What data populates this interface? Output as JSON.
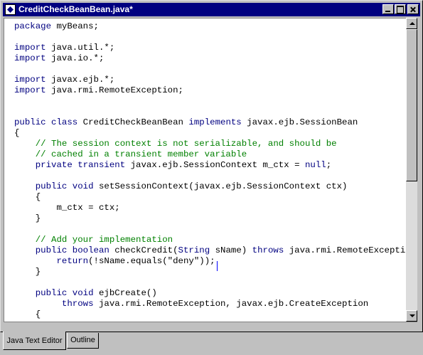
{
  "window": {
    "title": "CreditCheckBeanBean.java*"
  },
  "editor": {
    "lines": [
      [
        {
          "t": "package",
          "c": "kw"
        },
        {
          "t": " myBeans;",
          "c": "st"
        }
      ],
      [],
      [
        {
          "t": "import",
          "c": "kw"
        },
        {
          "t": " java.util.*;",
          "c": "st"
        }
      ],
      [
        {
          "t": "import",
          "c": "kw"
        },
        {
          "t": " java.io.*;",
          "c": "st"
        }
      ],
      [],
      [
        {
          "t": "import",
          "c": "kw"
        },
        {
          "t": " javax.ejb.*;",
          "c": "st"
        }
      ],
      [
        {
          "t": "import",
          "c": "kw"
        },
        {
          "t": " java.rmi.RemoteException;",
          "c": "st"
        }
      ],
      [],
      [],
      [
        {
          "t": "public class",
          "c": "kw"
        },
        {
          "t": " CreditCheckBeanBean ",
          "c": "st"
        },
        {
          "t": "implements",
          "c": "kw"
        },
        {
          "t": " javax.ejb.SessionBean",
          "c": "st"
        }
      ],
      [
        {
          "t": "{",
          "c": "st"
        }
      ],
      [
        {
          "t": "    // The session context is not serializable, and should be",
          "c": "cm"
        }
      ],
      [
        {
          "t": "    // cached in a transient member variable",
          "c": "cm"
        }
      ],
      [
        {
          "t": "    ",
          "c": "st"
        },
        {
          "t": "private transient",
          "c": "kw"
        },
        {
          "t": " javax.ejb.SessionContext m_ctx = ",
          "c": "st"
        },
        {
          "t": "null",
          "c": "kw"
        },
        {
          "t": ";",
          "c": "st"
        }
      ],
      [],
      [
        {
          "t": "    ",
          "c": "st"
        },
        {
          "t": "public void",
          "c": "kw"
        },
        {
          "t": " setSessionContext(javax.ejb.SessionContext ctx)",
          "c": "st"
        }
      ],
      [
        {
          "t": "    {",
          "c": "st"
        }
      ],
      [
        {
          "t": "        m_ctx = ctx;",
          "c": "st"
        }
      ],
      [
        {
          "t": "    }",
          "c": "st"
        }
      ],
      [],
      [
        {
          "t": "    // Add your implementation",
          "c": "cm"
        }
      ],
      [
        {
          "t": "    ",
          "c": "st"
        },
        {
          "t": "public boolean",
          "c": "kw"
        },
        {
          "t": " checkCredit(",
          "c": "st"
        },
        {
          "t": "String",
          "c": "kw"
        },
        {
          "t": " sName) ",
          "c": "st"
        },
        {
          "t": "throws",
          "c": "kw"
        },
        {
          "t": " java.rmi.RemoteException {",
          "c": "st"
        }
      ],
      [
        {
          "t": "        ",
          "c": "st"
        },
        {
          "t": "return",
          "c": "kw"
        },
        {
          "t": "(!sName.equals(\"deny\"));",
          "c": "st"
        }
      ],
      [
        {
          "t": "    }",
          "c": "st"
        }
      ],
      [],
      [
        {
          "t": "    ",
          "c": "st"
        },
        {
          "t": "public void",
          "c": "kw"
        },
        {
          "t": " ejbCreate()",
          "c": "st"
        }
      ],
      [
        {
          "t": "         ",
          "c": "st"
        },
        {
          "t": "throws",
          "c": "kw"
        },
        {
          "t": " java.rmi.RemoteException, javax.ejb.CreateException",
          "c": "st"
        }
      ],
      [
        {
          "t": "    {",
          "c": "st"
        }
      ]
    ]
  },
  "tabs": {
    "active_label": "Java Text Editor",
    "outline_label": "Outline"
  }
}
